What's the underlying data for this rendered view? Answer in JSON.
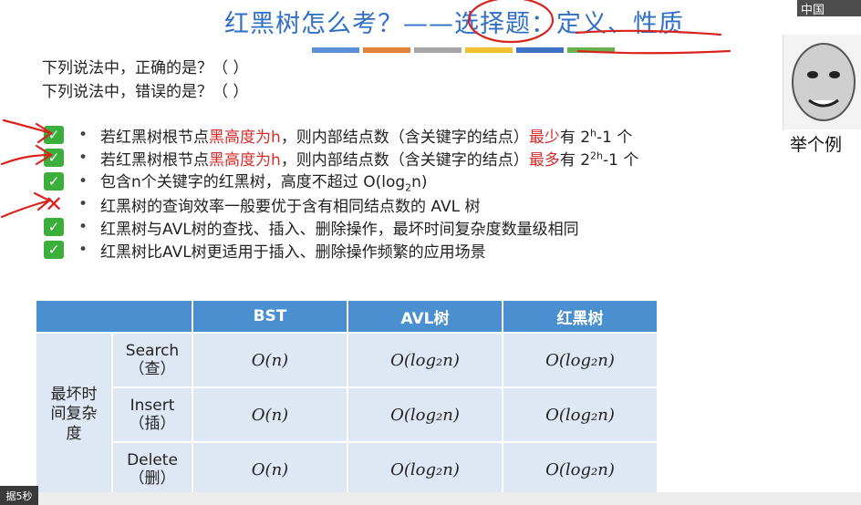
{
  "title": "红黑树怎么考？——选择题：定义、性质",
  "accent_colors": [
    "#5b8fd6",
    "#e2823a",
    "#a6a6a6",
    "#f0c033",
    "#3f72c4",
    "#6ab04c"
  ],
  "questions": [
    "下列说法中，正确的是？（ ）",
    "下列说法中，错误的是？（ ）"
  ],
  "statements": [
    {
      "mark": "check",
      "pre": "若红黑树根节点",
      "red": "黑高度为h",
      "mid": "，则内部结点数（含关键字的结点）",
      "red2": "最少",
      "post": "有 2",
      "sup": "h",
      "tail": "-1 个"
    },
    {
      "mark": "check",
      "pre": "若红黑树根节点",
      "red": "黑高度为h",
      "mid": "，则内部结点数（含关键字的结点）",
      "red2": "最多",
      "post": "有 2",
      "sup": "2h",
      "tail": "-1 个"
    },
    {
      "mark": "check",
      "text": "包含n个关键字的红黑树，高度不超过 O(log",
      "sub": "2",
      "tail": "n)"
    },
    {
      "mark": "cross",
      "text": "红黑树的查询效率一般要优于含有相同结点数的 AVL 树"
    },
    {
      "mark": "check",
      "text": "红黑树与AVL树的查找、插入、删除操作，最坏时间复杂度数量级相同"
    },
    {
      "mark": "check",
      "text": "红黑树比AVL树更适用于插入、删除操作频繁的应用场景"
    }
  ],
  "table": {
    "headers": [
      "BST",
      "AVL树",
      "红黑树"
    ],
    "row_group": "最坏时间复杂度",
    "row_group_lines": [
      "最坏时",
      "间复杂",
      "度"
    ],
    "ops": [
      {
        "name": "Search",
        "cn": "（查）"
      },
      {
        "name": "Insert",
        "cn": "（插）"
      },
      {
        "name": "Delete",
        "cn": "（删）"
      }
    ],
    "cells": [
      [
        "O(n)",
        "O(log₂n)",
        "O(log₂n)"
      ],
      [
        "O(n)",
        "O(log₂n)",
        "O(log₂n)"
      ],
      [
        "O(n)",
        "O(log₂n)",
        "O(log₂n)"
      ]
    ]
  },
  "meme_caption": "举个例",
  "logo_text": "中国",
  "timer": "据5秒"
}
